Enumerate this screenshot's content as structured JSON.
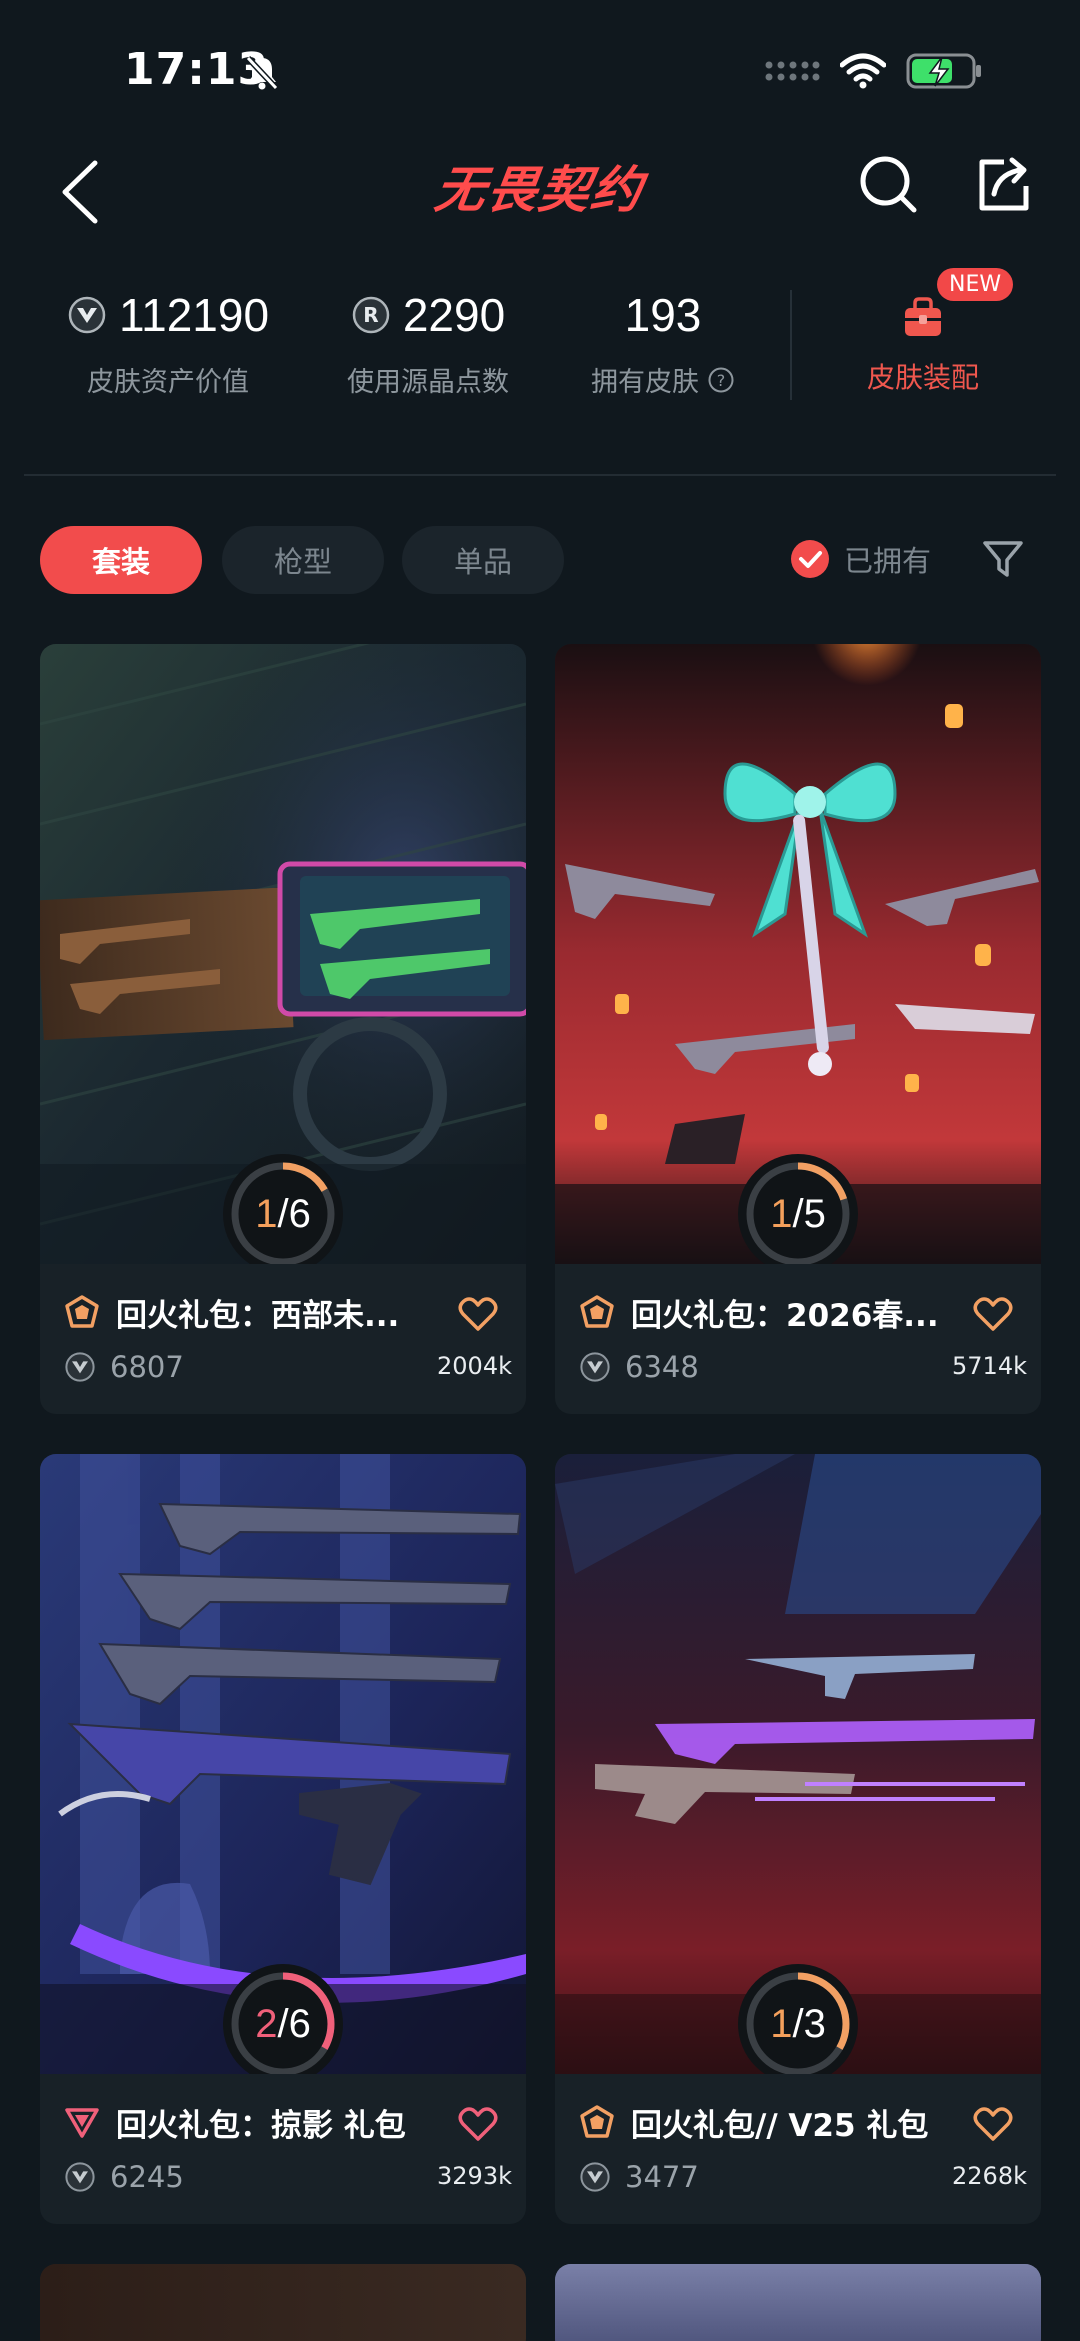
{
  "status_bar": {
    "time": "17:13",
    "icons": [
      "bell-muted-icon",
      "signal-dots-icon",
      "wifi-icon",
      "battery-charging-icon"
    ],
    "battery_color": "#3ee06a"
  },
  "header": {
    "title": "无畏契约",
    "title_color": "#ff4c4c",
    "back_icon": "chevron-left-icon",
    "search_icon": "search-icon",
    "share_icon": "share-icon"
  },
  "stats": {
    "asset_value": "112190",
    "asset_value_label": "皮肤资产价值",
    "radiant_points": "2290",
    "radiant_points_label": "使用源晶点数",
    "owned_skins": "193",
    "owned_skins_label": "拥有皮肤",
    "outfit_badge": "NEW",
    "outfit_label": "皮肤装配"
  },
  "filters": {
    "tabs": [
      "套装",
      "枪型",
      "单品"
    ],
    "active_tab": "套装",
    "owned_label": "已拥有",
    "owned_checked": true
  },
  "cards": [
    {
      "name": "回火礼包：西部未...",
      "price": "6807",
      "likes": "2004k",
      "owned": 1,
      "total": 6,
      "tier_color": "#f2a063",
      "ring_color": "#f2a063",
      "liked": false
    },
    {
      "name": "回火礼包：2026春...",
      "price": "6348",
      "likes": "5714k",
      "owned": 1,
      "total": 5,
      "tier_color": "#f2a063",
      "ring_color": "#f2a063",
      "liked": false
    },
    {
      "name": "回火礼包：掠影 礼包",
      "price": "6245",
      "likes": "3293k",
      "owned": 2,
      "total": 6,
      "tier_color": "#f0607a",
      "ring_color": "#f0607a",
      "liked": false
    },
    {
      "name": "回火礼包// V25 礼包",
      "price": "3477",
      "likes": "2268k",
      "owned": 1,
      "total": 3,
      "tier_color": "#f2a063",
      "ring_color": "#f2a063",
      "liked": false
    }
  ],
  "accent_color": "#f24c4c"
}
